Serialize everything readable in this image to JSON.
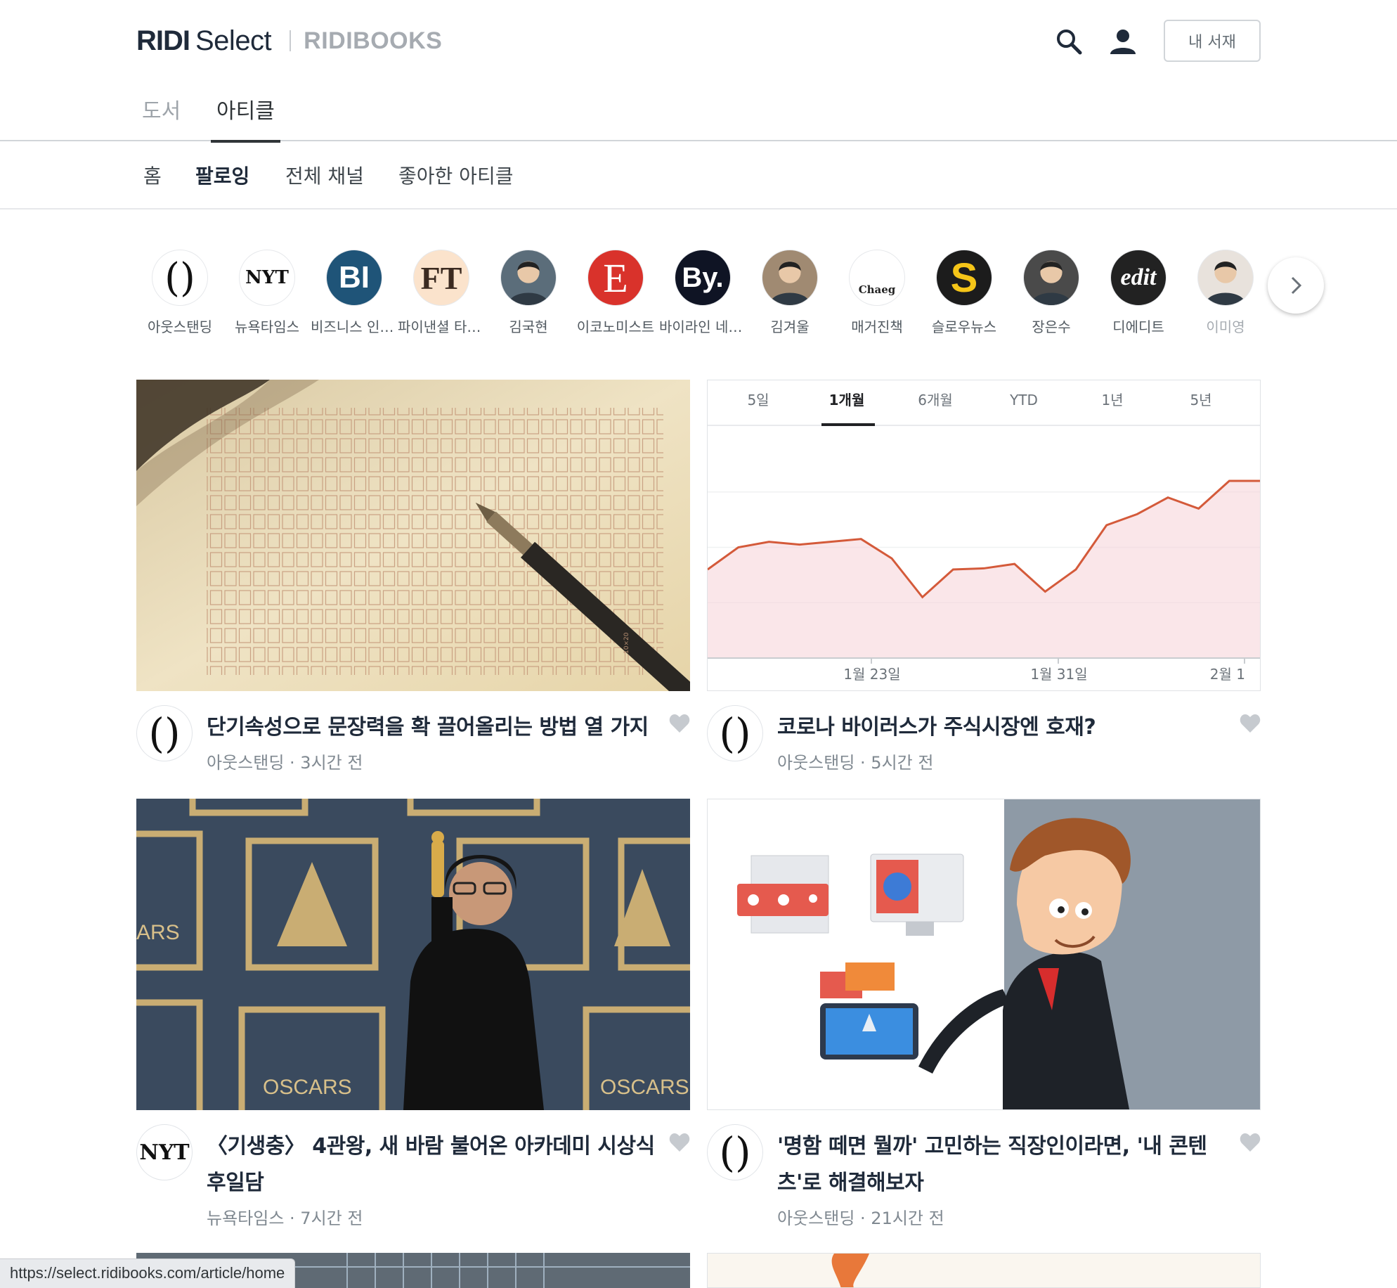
{
  "header": {
    "logo_primary": "RIDI",
    "logo_secondary": "Select",
    "logo_books": "RIDIBOOKS",
    "library_button": "내 서재"
  },
  "main_tabs": [
    {
      "label": "도서",
      "active": false
    },
    {
      "label": "아티클",
      "active": true
    }
  ],
  "sub_nav": [
    {
      "label": "홈",
      "active": false
    },
    {
      "label": "팔로잉",
      "active": true
    },
    {
      "label": "전체 채널",
      "active": false
    },
    {
      "label": "좋아한 아티클",
      "active": false
    }
  ],
  "channels": [
    {
      "name": "아웃스탠딩",
      "logo": "()",
      "bg": "#ffffff",
      "fg": "#111111"
    },
    {
      "name": "뉴욕타임스",
      "logo": "NYT",
      "bg": "#ffffff",
      "fg": "#111111"
    },
    {
      "name": "비즈니스 인사이더",
      "logo": "BI",
      "bg": "#1f5478",
      "fg": "#ffffff"
    },
    {
      "name": "파이낸셜 타임스",
      "logo": "FT",
      "bg": "#fbe3cc",
      "fg": "#3b2a20"
    },
    {
      "name": "김국현",
      "logo": "",
      "bg": "#5b6d7a",
      "fg": "#ffffff"
    },
    {
      "name": "이코노미스트",
      "logo": "E",
      "bg": "#d9322b",
      "fg": "#ffffff"
    },
    {
      "name": "바이라인 네트워크",
      "logo": "By.",
      "bg": "#0f1424",
      "fg": "#ffffff"
    },
    {
      "name": "김겨울",
      "logo": "",
      "bg": "#a08a72",
      "fg": "#ffffff"
    },
    {
      "name": "매거진책",
      "logo": "Chaeg",
      "bg": "#ffffff",
      "fg": "#222222"
    },
    {
      "name": "슬로우뉴스",
      "logo": "S",
      "bg": "#1c1c1c",
      "fg": "#f5c518"
    },
    {
      "name": "장은수",
      "logo": "",
      "bg": "#4a4a4a",
      "fg": "#ffffff"
    },
    {
      "name": "디에디트",
      "logo": "edit",
      "bg": "#222222",
      "fg": "#ffffff"
    },
    {
      "name": "이미영",
      "logo": "",
      "bg": "#e8e2dc",
      "fg": "#555555"
    }
  ],
  "chart_card": {
    "ranges": [
      "5일",
      "1개월",
      "6개월",
      "YTD",
      "1년",
      "5년"
    ],
    "active_range": "1개월",
    "x_labels": [
      "1월 23일",
      "1월 31일",
      "2월 1"
    ]
  },
  "chart_data": {
    "type": "area",
    "title": "",
    "xlabel": "",
    "ylabel": "",
    "x": [
      1,
      2,
      3,
      4,
      5,
      6,
      7,
      8,
      9,
      10,
      11,
      12,
      13,
      14,
      15,
      16,
      17,
      18,
      19
    ],
    "series": [
      {
        "values": [
          36,
          40,
          41,
          40.5,
          41,
          41.5,
          38,
          31,
          36,
          36.2,
          37,
          32,
          36,
          44,
          46,
          49,
          47,
          52,
          52
        ]
      }
    ],
    "ylim": [
      20,
      60
    ],
    "x_tick_labels": [
      "1월 23일",
      "1월 31일",
      "2월 1"
    ],
    "grid": true,
    "line_color": "#d45a3a",
    "fill_color": "#f6d6db"
  },
  "articles": [
    {
      "title": "단기속성으로 문장력을 확 끌어올리는 방법 열 가지",
      "source": "아웃스탠딩",
      "time": "3시간 전",
      "sep": " · ",
      "avatar": "()"
    },
    {
      "title": "코로나 바이러스가 주식시장엔 호재?",
      "source": "아웃스탠딩",
      "time": "5시간 전",
      "sep": " · ",
      "avatar": "()"
    },
    {
      "title": "〈기생충〉 4관왕, 새 바람 불어온 아카데미 시상식 후일담",
      "source": "뉴욕타임스",
      "time": "7시간 전",
      "sep": " · ",
      "avatar": "NYT"
    },
    {
      "title": "'명함 떼면 뭘까' 고민하는 직장인이라면, '내 콘텐츠'로 해결해보자",
      "source": "아웃스탠딩",
      "time": "21시간 전",
      "sep": " · ",
      "avatar": "()"
    }
  ],
  "image_texts": {
    "oscar_wall": "OSCARS",
    "oscar_wall_partial": "ARS",
    "grid_mark": "10×20"
  },
  "status_url": "https://select.ridibooks.com/article/home"
}
